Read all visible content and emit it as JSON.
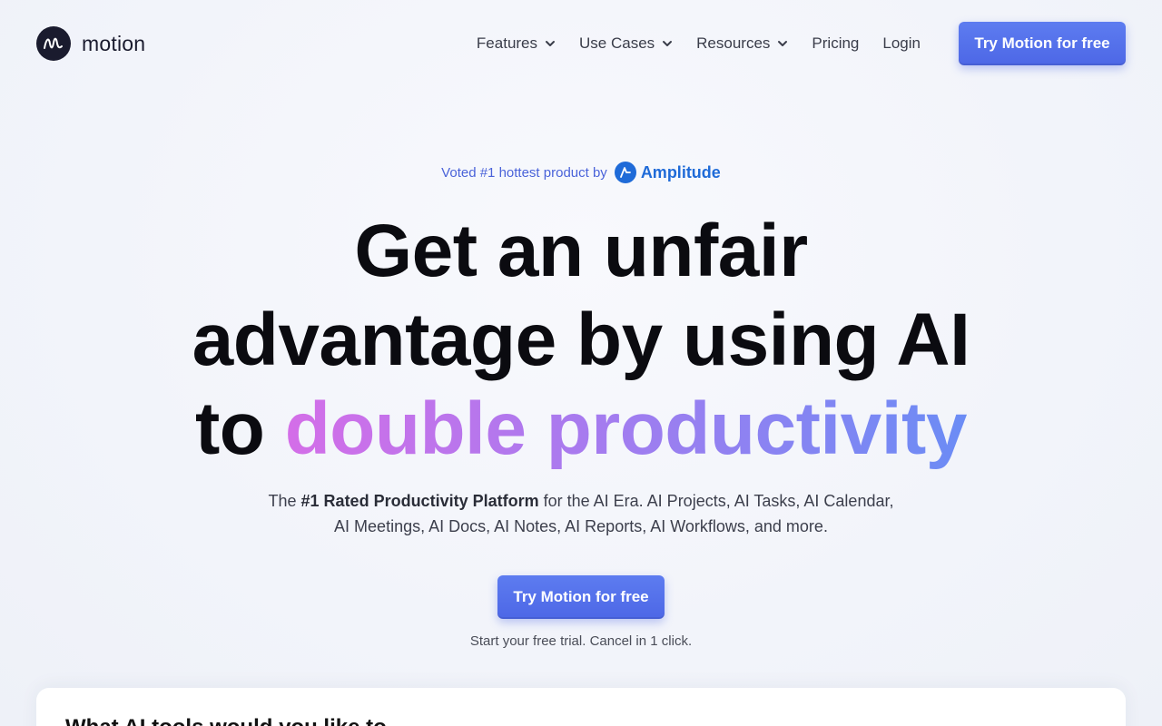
{
  "brand": {
    "name": "motion"
  },
  "nav": {
    "items": [
      {
        "label": "Features",
        "has_dropdown": true
      },
      {
        "label": "Use Cases",
        "has_dropdown": true
      },
      {
        "label": "Resources",
        "has_dropdown": true
      },
      {
        "label": "Pricing",
        "has_dropdown": false
      },
      {
        "label": "Login",
        "has_dropdown": false
      }
    ],
    "cta_label": "Try Motion for free"
  },
  "hero": {
    "voted_text": "Voted #1 hottest product by",
    "voted_brand": "Amplitude",
    "headline_line1": "Get an unfair",
    "headline_line2": "advantage by using AI",
    "headline_line3_prefix": "to ",
    "headline_line3_highlight": "double productivity",
    "sub_prefix": "The ",
    "sub_bold": "#1 Rated Productivity Platform",
    "sub_suffix": " for the AI Era. AI Projects, AI Tasks, AI Calendar, AI Meetings, AI Docs, AI Notes, AI Reports, AI Workflows, and more.",
    "cta_label": "Try Motion for free",
    "trial_note": "Start your free trial. Cancel in 1 click."
  },
  "card": {
    "title_partial": "What AI tools would you like to"
  },
  "colors": {
    "accent": "#4d67e6",
    "amplitude": "#1f6bd8",
    "gradient_start": "#d46ee8",
    "gradient_end": "#6b8cf5"
  }
}
